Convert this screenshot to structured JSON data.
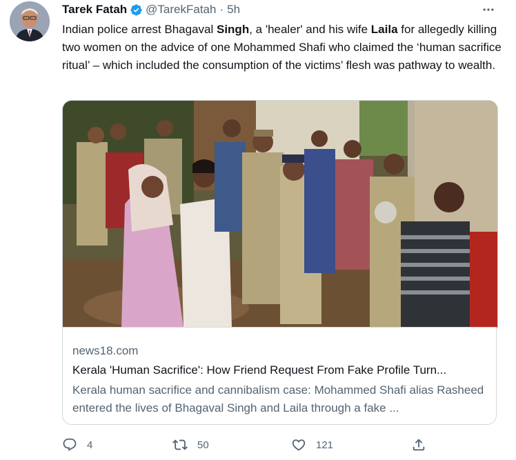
{
  "author": {
    "name": "Tarek Fatah",
    "handle": "@TarekFatah",
    "separator": "·",
    "time": "5h"
  },
  "tweet": {
    "segments": [
      {
        "text": "Indian police arrest Bhagaval ",
        "bold": false
      },
      {
        "text": "Singh",
        "bold": true
      },
      {
        "text": ", a 'healer' and his wife ",
        "bold": false
      },
      {
        "text": "Laila",
        "bold": true
      },
      {
        "text": " for allegedly killing two women on the advice of one Mohammed Shafi who claimed the ‘human sacrifice ritual’ – which included the consumption of the victims’ flesh was pathway to wealth.",
        "bold": false
      }
    ]
  },
  "card": {
    "domain": "news18.com",
    "title": "Kerala 'Human Sacrifice': How Friend Request From Fake Profile Turn...",
    "description": "Kerala human sacrifice and cannibalism case: Mohammed Shafi alias Rasheed entered the lives of Bhagaval Singh and Laila through a fake ..."
  },
  "actions": {
    "replies": "4",
    "retweets": "50",
    "likes": "121"
  },
  "icons": {
    "verified": "verified-badge-icon",
    "more": "more-horizontal-icon",
    "reply": "reply-icon",
    "retweet": "retweet-icon",
    "like": "heart-icon",
    "share": "share-icon"
  },
  "colors": {
    "verified_blue": "#1d9bf0",
    "text": "#0f1419",
    "muted": "#536471",
    "border": "#cfd9de"
  }
}
